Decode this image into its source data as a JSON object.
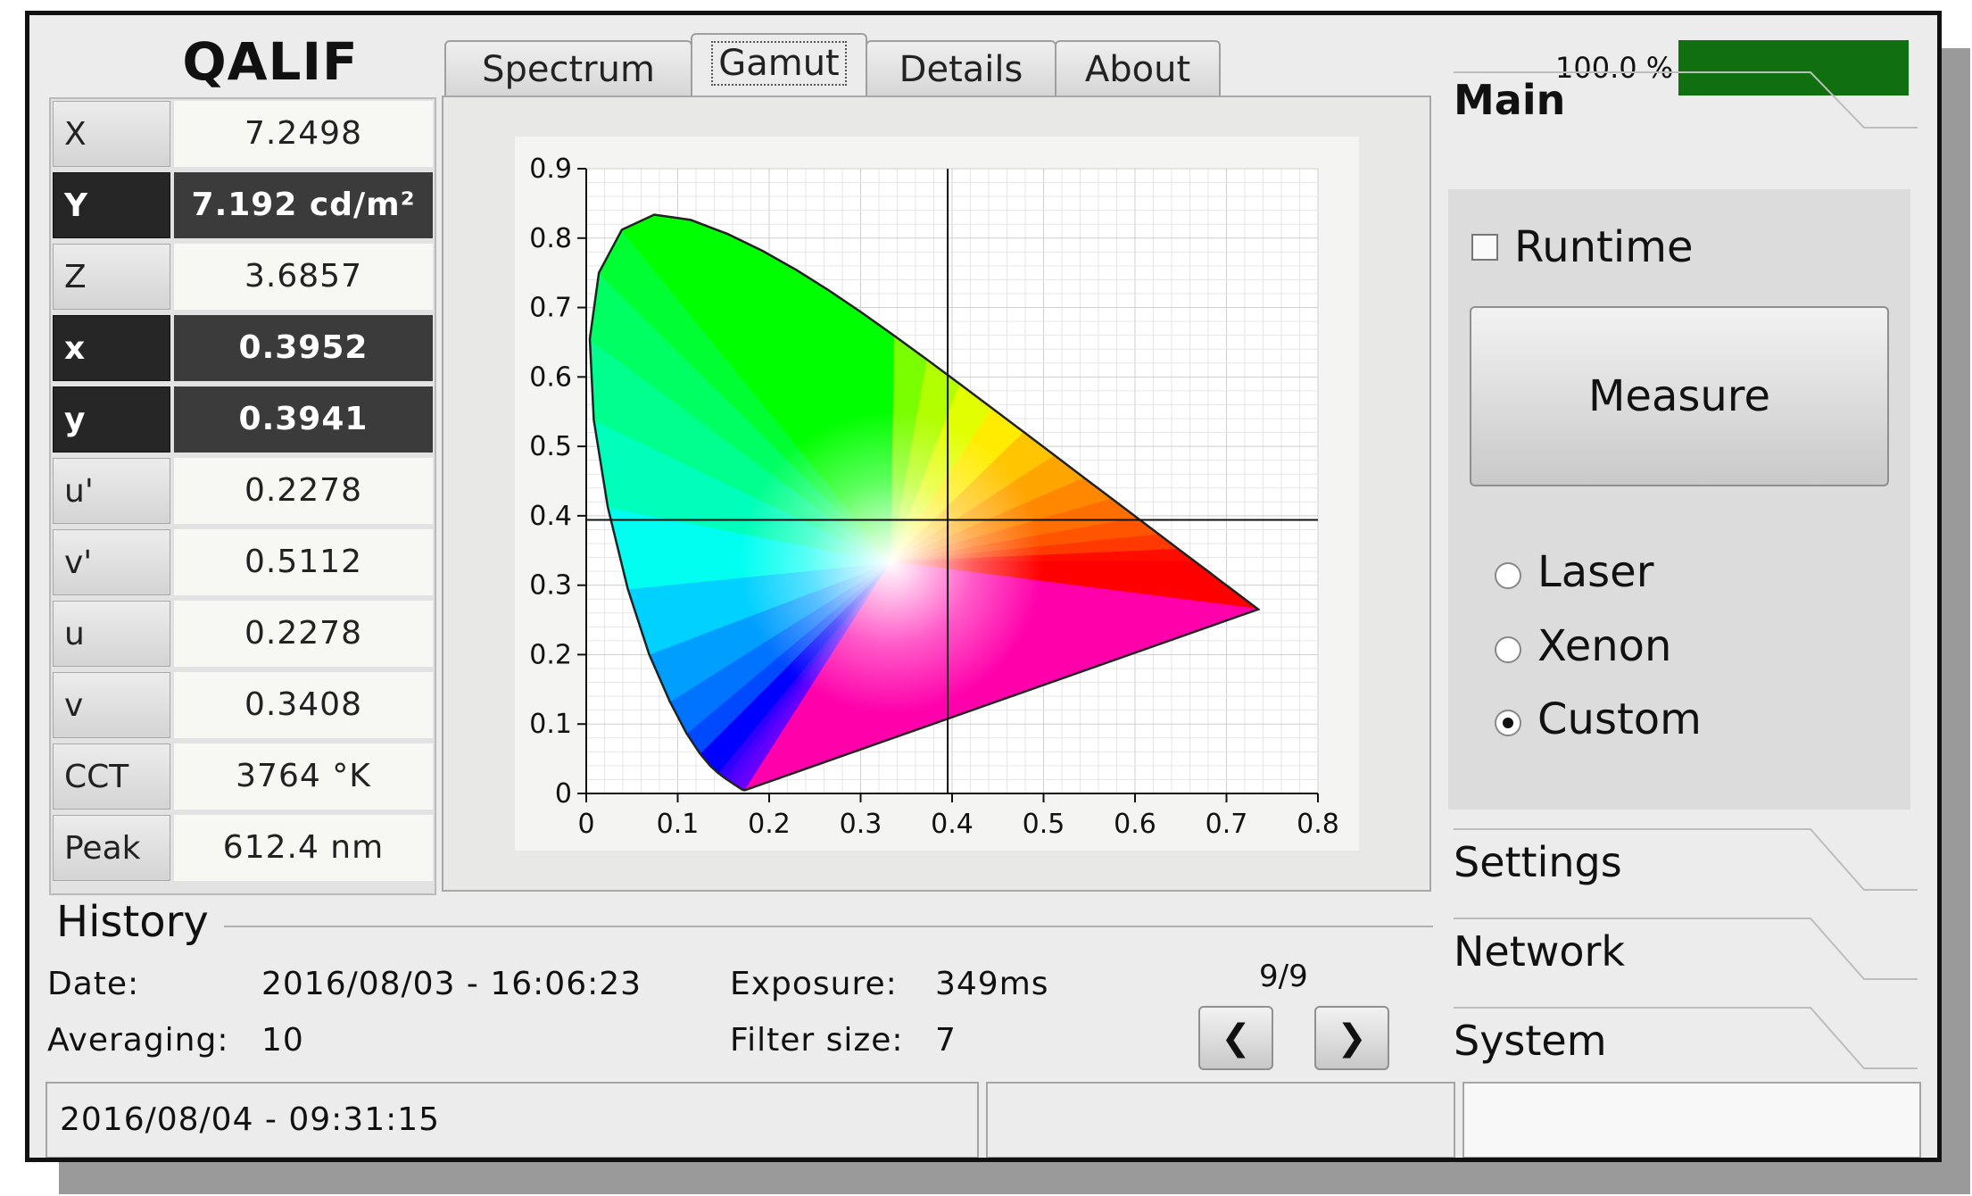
{
  "app": {
    "title": "QALIF"
  },
  "tabs": [
    {
      "label": "Spectrum",
      "active": false
    },
    {
      "label": "Gamut",
      "active": true
    },
    {
      "label": "Details",
      "active": false
    },
    {
      "label": "About",
      "active": false
    }
  ],
  "progress": {
    "label": "100.0 %",
    "fraction": 1.0,
    "color": "#107010"
  },
  "measurements": [
    {
      "label": "X",
      "value": "7.2498",
      "highlight": false
    },
    {
      "label": "Y",
      "value": "7.192 cd/m²",
      "highlight": true
    },
    {
      "label": "Z",
      "value": "3.6857",
      "highlight": false
    },
    {
      "label": "x",
      "value": "0.3952",
      "highlight": true
    },
    {
      "label": "y",
      "value": "0.3941",
      "highlight": true
    },
    {
      "label": "u'",
      "value": "0.2278",
      "highlight": false
    },
    {
      "label": "v'",
      "value": "0.5112",
      "highlight": false
    },
    {
      "label": "u",
      "value": "0.2278",
      "highlight": false
    },
    {
      "label": "v",
      "value": "0.3408",
      "highlight": false
    },
    {
      "label": "CCT",
      "value": "3764 °K",
      "highlight": false
    },
    {
      "label": "Peak",
      "value": "612.4 nm",
      "highlight": false
    }
  ],
  "chart_data": {
    "type": "scatter",
    "title": "",
    "xlabel": "",
    "ylabel": "",
    "xlim": [
      0,
      0.8
    ],
    "ylim": [
      0,
      0.9
    ],
    "xticks": [
      "0",
      "0.1",
      "0.2",
      "0.3",
      "0.4",
      "0.5",
      "0.6",
      "0.7",
      "0.8"
    ],
    "yticks": [
      "0",
      "0.1",
      "0.2",
      "0.3",
      "0.4",
      "0.5",
      "0.6",
      "0.7",
      "0.8",
      "0.9"
    ],
    "grid": true,
    "crosshair": {
      "x": 0.3952,
      "y": 0.3941
    },
    "locus_region": "CIE 1931 chromaticity diagram"
  },
  "side": {
    "main_title": "Main",
    "runtime_label": "Runtime",
    "runtime_checked": false,
    "measure_label": "Measure",
    "radios": [
      {
        "label": "Laser",
        "selected": false
      },
      {
        "label": "Xenon",
        "selected": false
      },
      {
        "label": "Custom",
        "selected": true
      }
    ],
    "settings_title": "Settings",
    "network_title": "Network",
    "system_title": "System"
  },
  "history": {
    "title": "History",
    "date_label": "Date:",
    "date_value": "2016/08/03 - 16:06:23",
    "averaging_label": "Averaging:",
    "averaging_value": "10",
    "exposure_label": "Exposure:",
    "exposure_value": "349ms",
    "filter_label": "Filter size:",
    "filter_value": "7",
    "page": "9/9",
    "prev_label": "❮",
    "next_label": "❯"
  },
  "status": {
    "timestamp": "2016/08/04 - 09:31:15",
    "middle": "",
    "right": ""
  }
}
